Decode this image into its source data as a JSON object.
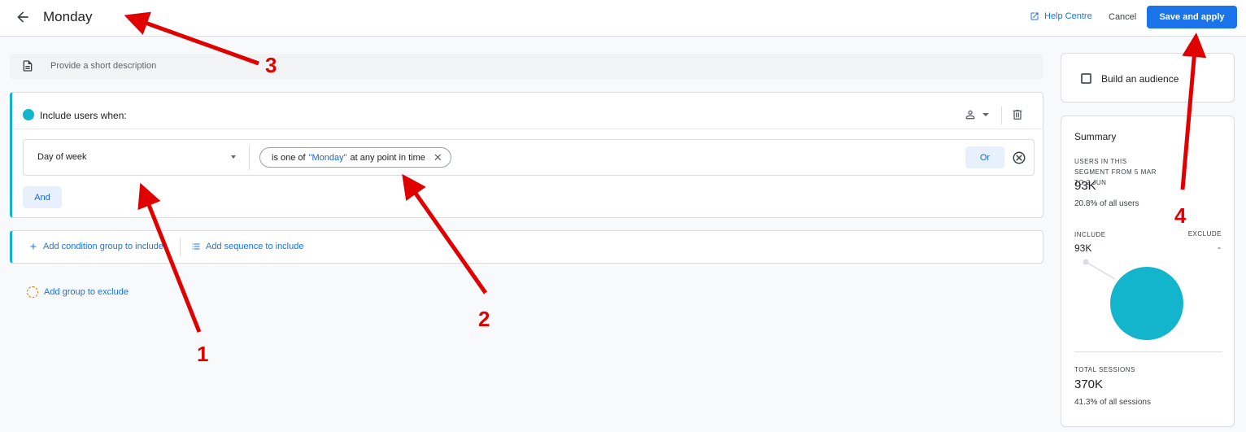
{
  "header": {
    "title": "Monday",
    "help_label": "Help Centre",
    "cancel_label": "Cancel",
    "save_label": "Save and apply"
  },
  "description": {
    "placeholder": "Provide a short description"
  },
  "include_group": {
    "label": "Include users when:",
    "condition": {
      "dimension": "Day of week",
      "chip_prefix": "is one of",
      "chip_value": "\"Monday\"",
      "chip_suffix": "at any point in time"
    },
    "or_label": "Or",
    "and_label": "And"
  },
  "add_actions": {
    "condition_group": "Add condition group to include",
    "sequence": "Add sequence to include",
    "exclude": "Add group to exclude"
  },
  "sidebar": {
    "audience_label": "Build an audience",
    "summary": {
      "title": "Summary",
      "users_caption": "USERS IN THIS SEGMENT FROM 5 MAR TO 2 JUN",
      "users_value": "93K",
      "users_pct": "20.8% of all users",
      "include_label": "INCLUDE",
      "include_value": "93K",
      "exclude_label": "EXCLUDE",
      "exclude_value": "-",
      "sessions_caption": "TOTAL SESSIONS",
      "sessions_value": "370K",
      "sessions_pct": "41.3% of all sessions"
    }
  },
  "annotations": [
    "1",
    "2",
    "3",
    "4"
  ],
  "colors": {
    "accent": "#1a73e8",
    "segment": "#12b5cb",
    "annotation": "#e00000"
  },
  "icons": [
    "back-arrow-icon",
    "open-in-new-icon",
    "document-icon",
    "person-icon",
    "trash-icon",
    "close-icon",
    "cancel-circle-icon",
    "plus-icon",
    "list-icon",
    "dashed-circle-icon"
  ]
}
